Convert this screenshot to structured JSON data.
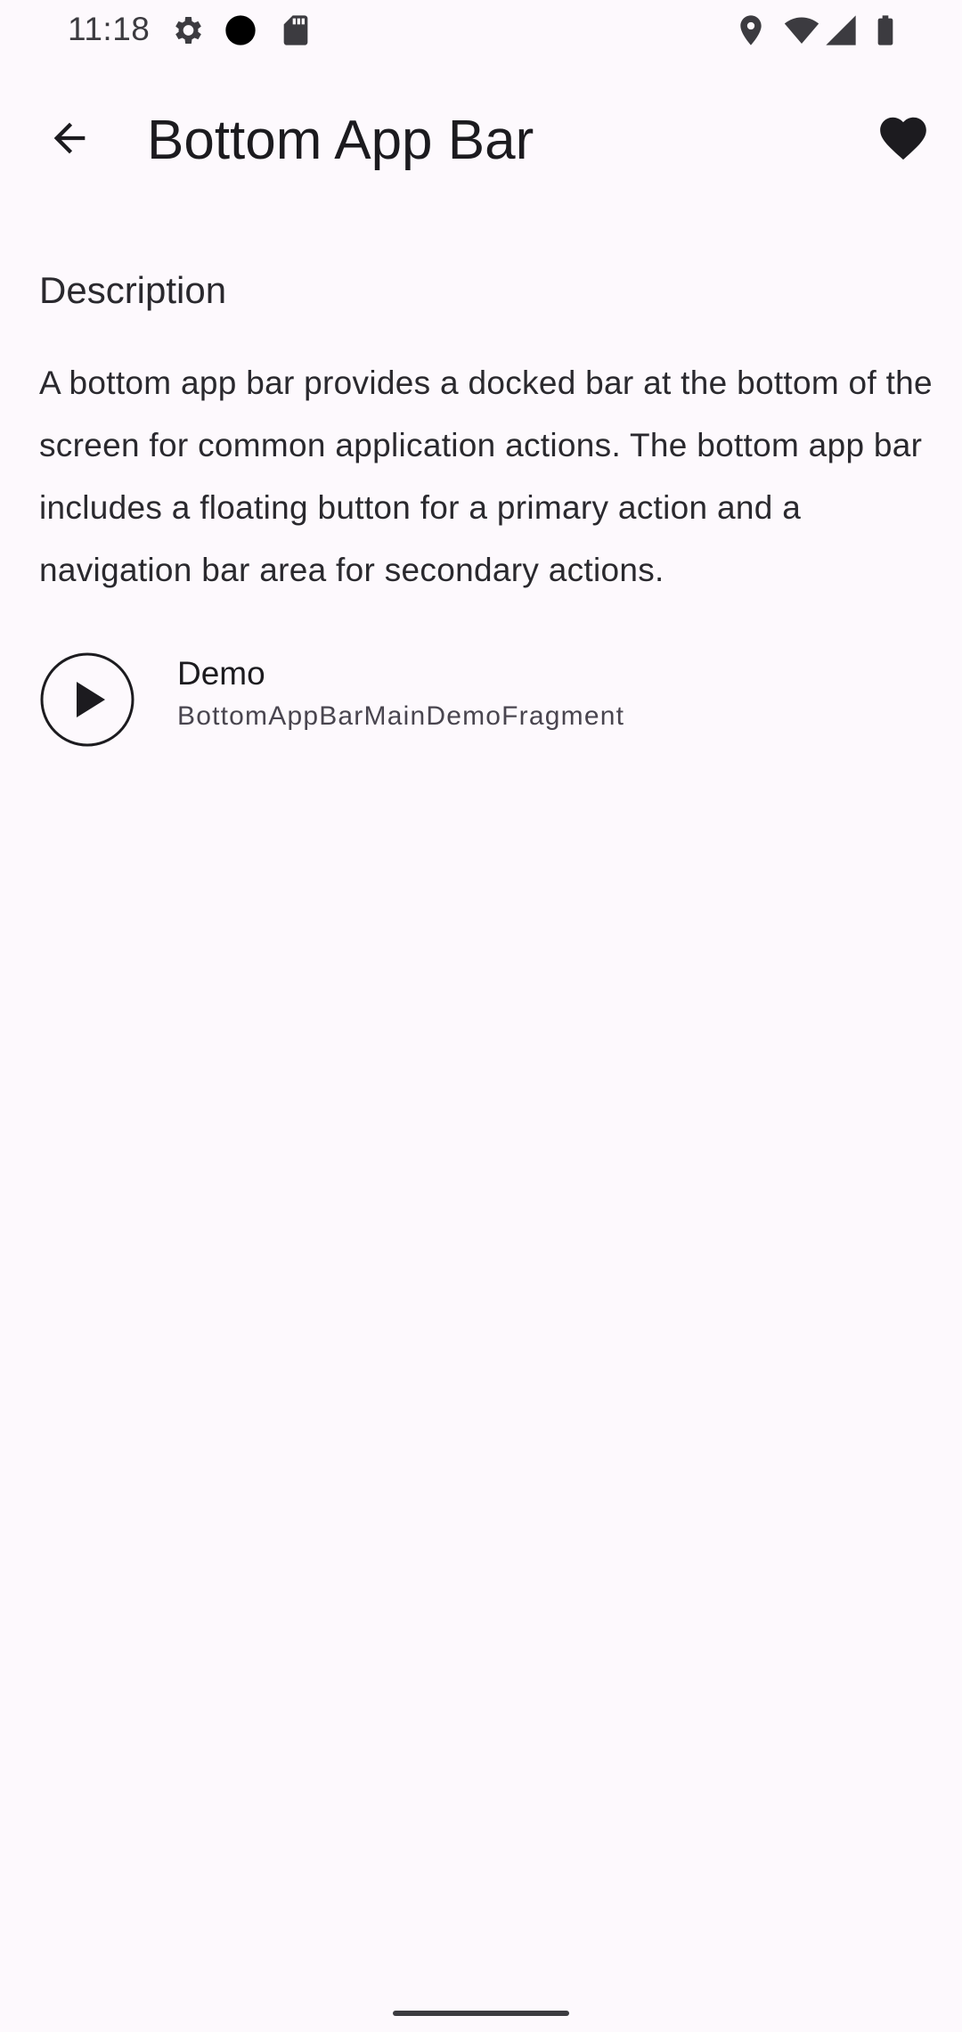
{
  "status_bar": {
    "time": "11:18",
    "icons": [
      "gear-icon",
      "dot-icon",
      "sd-card-icon",
      "location-icon",
      "wifi-icon",
      "signal-icon",
      "battery-icon"
    ]
  },
  "toolbar": {
    "title": "Bottom App Bar",
    "back_icon": "arrow-back-icon",
    "favorite_icon": "heart-icon"
  },
  "content": {
    "section_heading": "Description",
    "description": "A bottom app bar provides a docked bar at the bottom of the screen for common application actions. The bottom app bar includes a floating button for a primary action and a navigation bar area for secondary actions.",
    "demos": [
      {
        "title": "Demo",
        "subtitle": "BottomAppBarMainDemoFragment",
        "icon": "play-circle-icon"
      }
    ]
  },
  "colors": {
    "background": "#fdf9fd",
    "text_primary": "#1c1b1f",
    "text_secondary": "#49454f"
  }
}
